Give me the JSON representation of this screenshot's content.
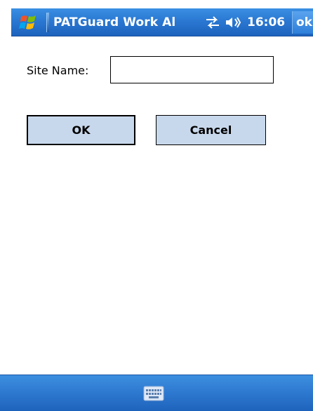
{
  "titlebar": {
    "title": "PATGuard Work Al",
    "clock": "16:06",
    "ok_label": "ok",
    "icons": {
      "start": "windows-start-icon",
      "connectivity": "connectivity-icon",
      "volume": "volume-icon"
    },
    "colors": {
      "bar": "#2a78d2",
      "text": "#ffffff"
    }
  },
  "form": {
    "site_name_label": "Site Name:",
    "site_name_value": "",
    "site_name_placeholder": ""
  },
  "buttons": {
    "ok_label": "OK",
    "cancel_label": "Cancel",
    "color": "#c8d8ec"
  },
  "bottombar": {
    "icons": {
      "keyboard": "keyboard-icon"
    }
  }
}
